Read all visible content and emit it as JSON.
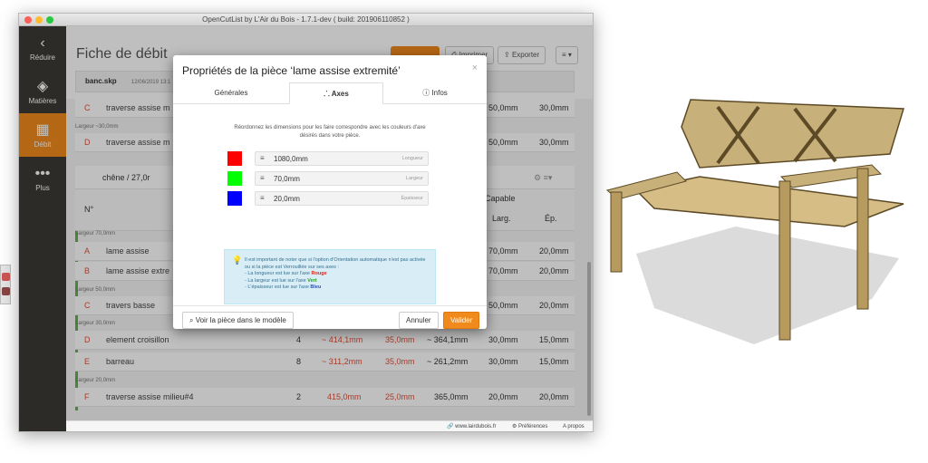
{
  "window": {
    "title": "OpenCutList by L'Air du Bois - 1.7.1-dev ( build: 201906110852 )"
  },
  "sidebar": {
    "items": [
      {
        "label": "Réduire",
        "icon": "chevron-left-icon"
      },
      {
        "label": "Matières",
        "icon": "materials-icon"
      },
      {
        "label": "Débit",
        "icon": "table-icon"
      },
      {
        "label": "Plus",
        "icon": "more-icon"
      }
    ]
  },
  "header": {
    "title": "Fiche de débit",
    "buttons": [
      "Imprimer",
      "Exporter"
    ],
    "file": "banc.skp",
    "date": "12/06/2019 13:1"
  },
  "background_rows": [
    {
      "letter": "C",
      "name": "traverse assise m",
      "larg": "50,0mm",
      "ep": "30,0mm"
    },
    {
      "letter": "D",
      "name": "traverse assise m",
      "larg": "50,0mm",
      "ep": "30,0mm"
    }
  ],
  "group": {
    "label": "chêne / 27,0r",
    "col_no": "N°",
    "col_capable": "Capable",
    "col_larg": "Larg.",
    "col_ep": "Ép."
  },
  "group_labels": [
    "Largeur ~30,0mm",
    "Largeur 70,0mm",
    "Largeur 50,0mm",
    "Largeur 30,0mm",
    "Largeur 20,0mm"
  ],
  "parts": [
    {
      "letter": "A",
      "name": "lame assise",
      "larg": "70,0mm",
      "ep": "20,0mm"
    },
    {
      "letter": "B",
      "name": "lame assise extre",
      "larg": "70,0mm",
      "ep": "20,0mm"
    },
    {
      "letter": "C",
      "name": "travers basse",
      "larg": "50,0mm",
      "ep": "20,0mm"
    },
    {
      "letter": "D",
      "name": "element croisillon",
      "qty": "4",
      "len": "~ 414,1mm",
      "w": "35,0mm",
      "cut": "~ 364,1mm",
      "larg": "30,0mm",
      "ep": "15,0mm"
    },
    {
      "letter": "E",
      "name": "barreau",
      "qty": "8",
      "len": "~ 311,2mm",
      "w": "35,0mm",
      "cut": "~ 261,2mm",
      "larg": "30,0mm",
      "ep": "15,0mm"
    },
    {
      "letter": "F",
      "name": "traverse assise milieu#4",
      "qty": "2",
      "len": "415,0mm",
      "w": "25,0mm",
      "cut": "365,0mm",
      "larg": "20,0mm",
      "ep": "20,0mm"
    }
  ],
  "modal": {
    "title": "Propriétés de la pièce ‘lame assise extremité’",
    "tabs": [
      "Générales",
      "Axes",
      "Infos"
    ],
    "intro": "Réordonnez les dimensions pour les faire correspondre avec les couleurs d'axe désirés dans votre pièce.",
    "axes": [
      {
        "color": "#ff0000",
        "value": "1080,0mm",
        "label": "Longueur"
      },
      {
        "color": "#00ff00",
        "value": "70,0mm",
        "label": "Largeur"
      },
      {
        "color": "#0000ff",
        "value": "20,0mm",
        "label": "Épaisseur"
      }
    ],
    "info": {
      "line1": "Il est important de noter que si l'option d'Orientation automatique n'est pas activée ou si la pièce est Verrouillée sur ses axes :",
      "l_prefix": "- La longueur est lue sur l'axe ",
      "l_axis": "Rouge",
      "w_prefix": "- La largeur est lue sur l'axe ",
      "w_axis": "Vert",
      "t_prefix": "- L'épaisseur est lue sur l'axe ",
      "t_axis": "Bleu"
    },
    "view_button": "Voir la pièce dans le modèle",
    "cancel": "Annuler",
    "validate": "Valider"
  },
  "status": {
    "link": "www.lairdubois.fr",
    "prefs": "Préférences",
    "about": "A propos"
  }
}
